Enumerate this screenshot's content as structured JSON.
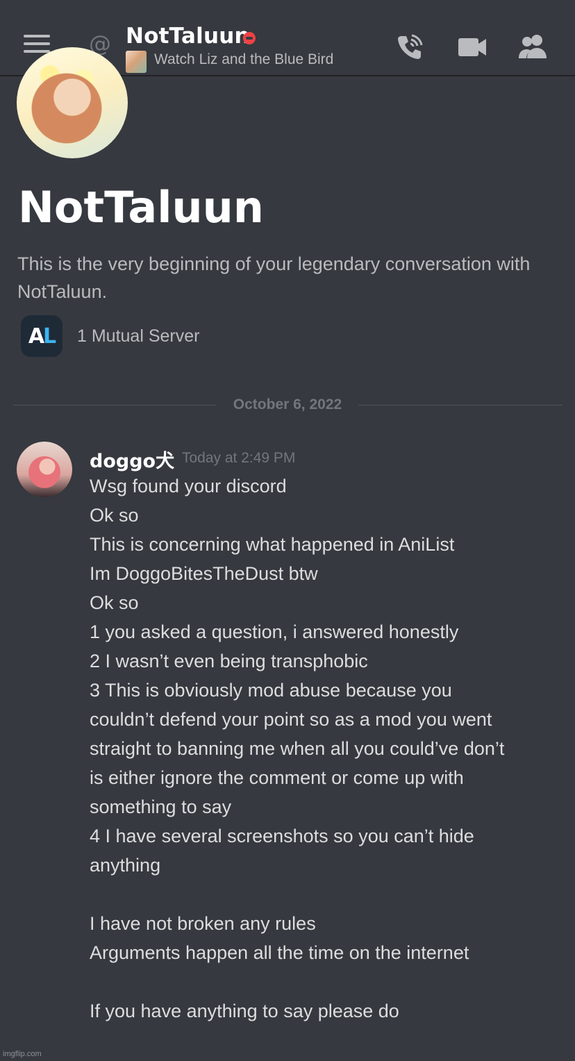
{
  "header": {
    "name": "NotTaluun",
    "status_activity": "Watch Liz and the Blue Bird",
    "icons": [
      "menu-icon",
      "at-icon",
      "dnd-status-icon",
      "voice-call-icon",
      "video-call-icon",
      "members-icon"
    ]
  },
  "intro": {
    "title": "NotTaluun",
    "description": "This is the very beginning of your legendary conversation with NotTaluun.",
    "mutual_server_icon_text_a": "A",
    "mutual_server_icon_text_l": "L",
    "mutual_servers": "1 Mutual Server"
  },
  "divider": {
    "date": "October 6, 2022"
  },
  "message": {
    "author": "doggo犬",
    "timestamp": "Today at 2:49 PM",
    "lines": [
      "Wsg found your discord",
      "Ok so",
      "This is concerning what happened in AniList",
      "Im DoggoBitesTheDust btw",
      "Ok so",
      "1 you asked a question, i answered honestly",
      "2 I wasn’t even being transphobic",
      "3 This is obviously mod abuse because you",
      "couldn’t defend your point so as a mod you went",
      "straight to banning me when all you could’ve don’t",
      "is either ignore the comment or come up with",
      "something to say",
      "4 I have several screenshots so you can’t hide",
      "anything",
      "",
      "I have not broken any rules",
      "Arguments happen all the time on the internet",
      "",
      "If you have anything to say please do"
    ]
  },
  "watermark": "imgflip.com",
  "colors": {
    "background": "#36393f",
    "header_border": "#202225",
    "title_text": "#ffffff",
    "body_text": "#dcddde",
    "muted_text": "#b9bbbe",
    "timestamp_text": "#72767d",
    "dnd_red": "#ed4245",
    "anilist_blue": "#3db4f2"
  }
}
